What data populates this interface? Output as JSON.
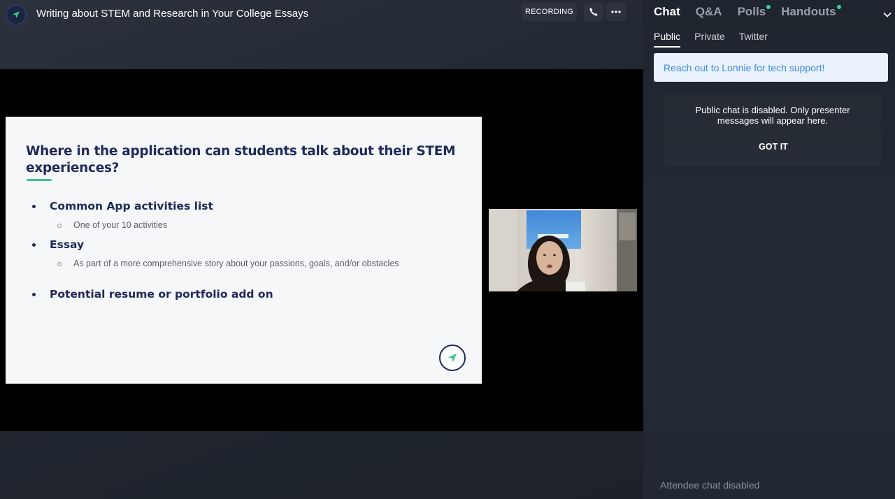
{
  "header": {
    "event_title": "Writing about STEM and Research in Your College Essays",
    "recording_label": "RECORDING",
    "phone_icon": "phone-icon",
    "more_icon": "more-horizontal-icon"
  },
  "slide": {
    "title": "Where in the application can students talk about their STEM experiences?",
    "bullets": [
      {
        "text": "Common App activities list",
        "sub": "One of your 10 activities"
      },
      {
        "text": "Essay",
        "sub": "As part of a more comprehensive story about your passions, goals, and/or obstacles"
      },
      {
        "text": "Potential resume or portfolio add on",
        "sub": ""
      }
    ],
    "accent_color": "#3ec78a",
    "text_color": "#1e2a5a"
  },
  "panel": {
    "tabs": [
      {
        "label": "Chat",
        "active": true,
        "notification": false
      },
      {
        "label": "Q&A",
        "active": false,
        "notification": false
      },
      {
        "label": "Polls",
        "active": false,
        "notification": true
      },
      {
        "label": "Handouts",
        "active": false,
        "notification": true
      }
    ],
    "subtabs": [
      {
        "label": "Public",
        "active": true
      },
      {
        "label": "Private",
        "active": false
      },
      {
        "label": "Twitter",
        "active": false
      }
    ],
    "pinned_message": "Reach out to Lonnie for tech support!",
    "notice_text": "Public chat is disabled. Only presenter messages will appear here.",
    "got_it_label": "GOT IT",
    "footer_status": "Attendee chat disabled",
    "notification_color": "#36d399",
    "link_color": "#3f8be0"
  }
}
